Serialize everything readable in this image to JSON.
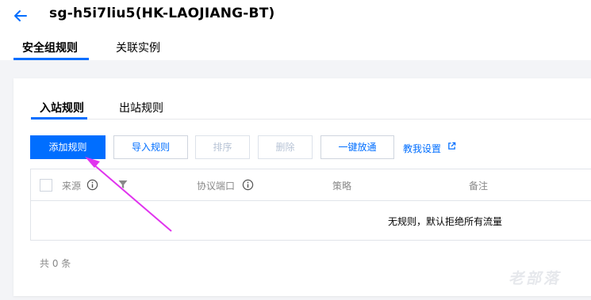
{
  "header": {
    "title": "sg-h5i7liu5(HK-LAOJIANG-BT)",
    "back_icon": "arrow-left-icon",
    "tabs": [
      {
        "label": "安全组规则",
        "active": true
      },
      {
        "label": "关联实例",
        "active": false
      }
    ]
  },
  "rules": {
    "subtabs": [
      {
        "label": "入站规则",
        "active": true
      },
      {
        "label": "出站规则",
        "active": false
      }
    ],
    "toolbar": {
      "add_label": "添加规则",
      "import_label": "导入规则",
      "sort_label": "排序",
      "delete_label": "删除",
      "allow_all_label": "一键放通",
      "help_label": "教我设置",
      "help_icon": "external-link-icon"
    },
    "table": {
      "columns": [
        "来源",
        "协议端口",
        "策略",
        "备注"
      ],
      "empty_text": "无规则，默认拒绝所有流量"
    },
    "count_text": "共 0 条"
  },
  "watermark": "老部落",
  "colors": {
    "accent": "#006eff",
    "annotation_arrow": "#e033ee"
  }
}
